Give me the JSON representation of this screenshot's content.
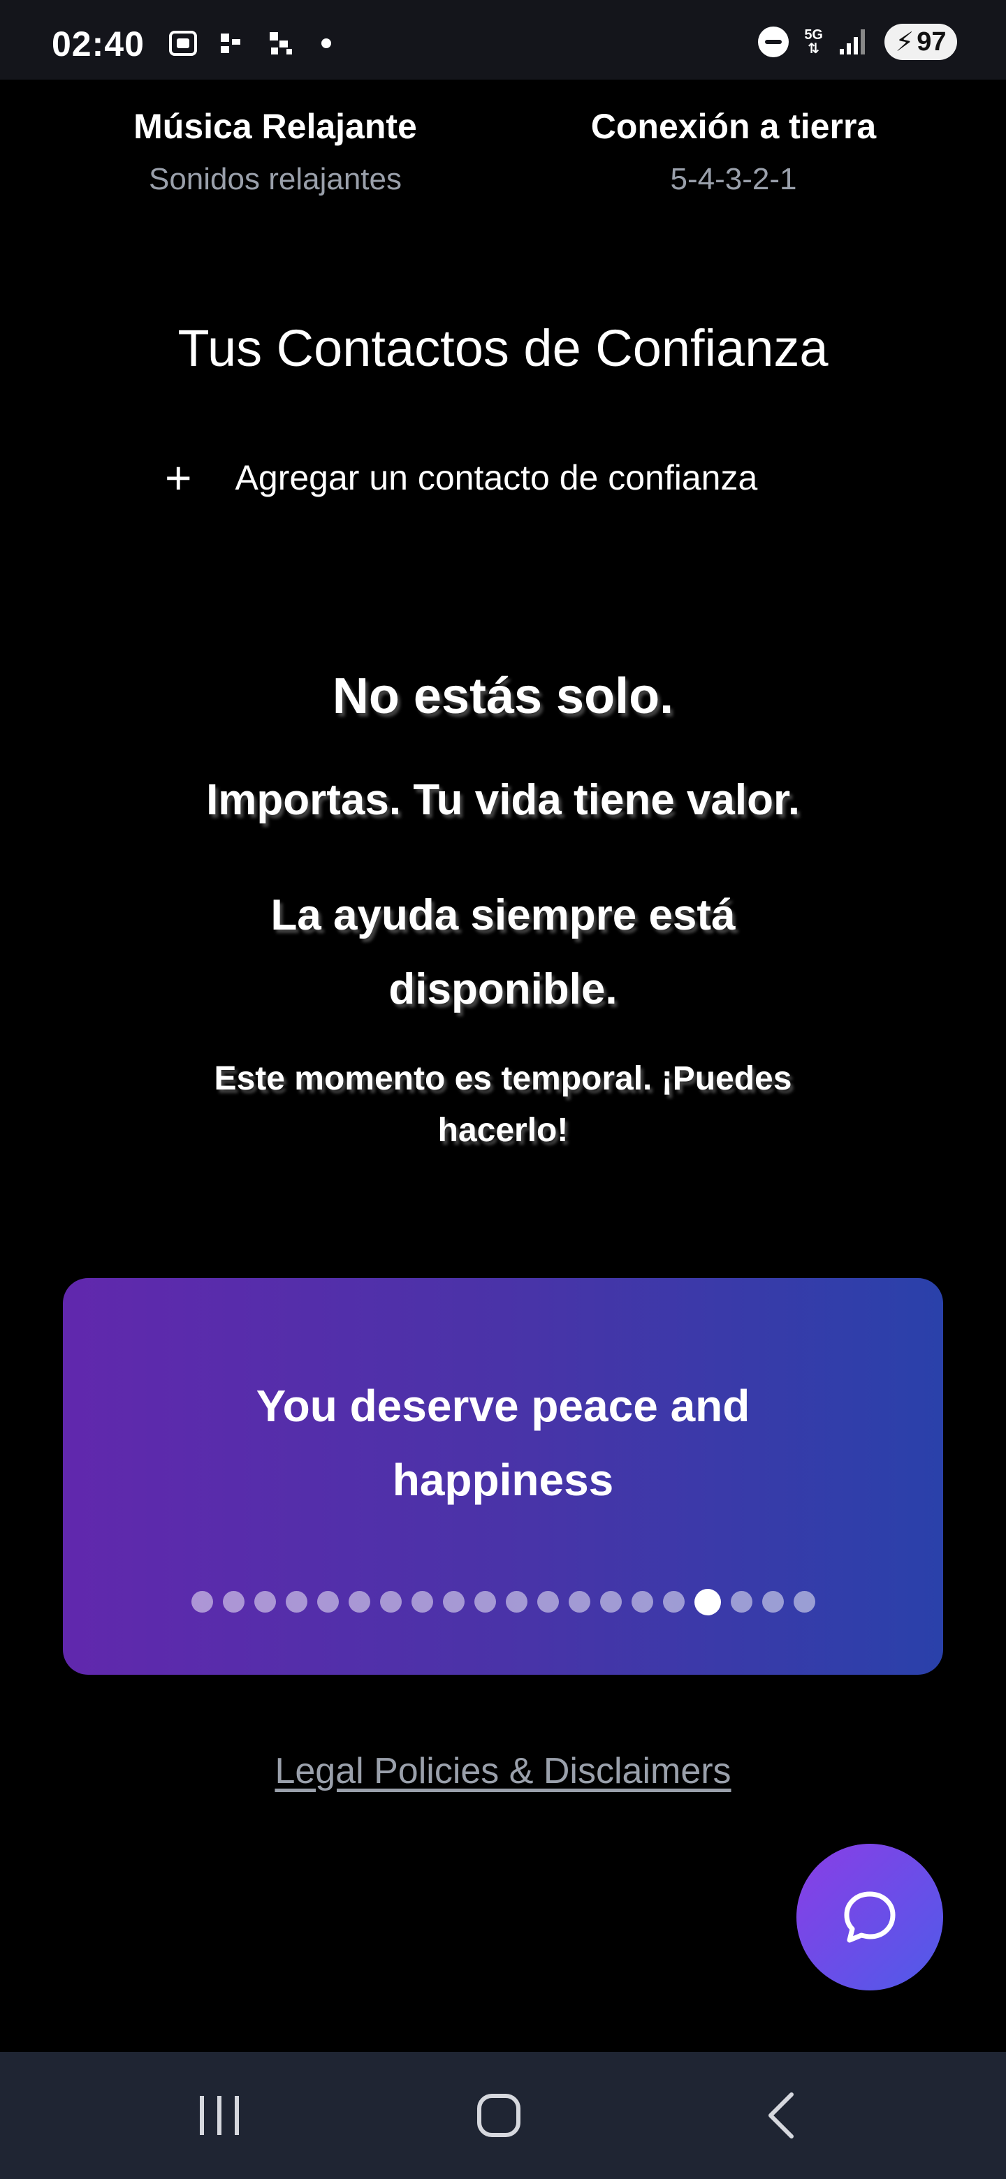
{
  "status_bar": {
    "time": "02:40",
    "network": "5G",
    "battery": "97"
  },
  "features": [
    {
      "title": "Música Relajante",
      "subtitle": "Sonidos relajantes"
    },
    {
      "title": "Conexión a tierra",
      "subtitle": "5-4-3-2-1"
    }
  ],
  "contacts": {
    "title": "Tus Contactos de Confianza",
    "add_label": "Agregar un contacto de confianza",
    "add_icon": "+"
  },
  "messages": {
    "line1": "No estás solo.",
    "line2": "Importas. Tu vida tiene valor.",
    "line3": "La ayuda siempre está disponible.",
    "line4": "Este momento es temporal. ¡Puedes hacerlo!"
  },
  "affirmation_card": {
    "text": "You deserve peace and happiness",
    "total_slides": 20,
    "active_slide": 17
  },
  "legal_link": "Legal Policies & Disclaimers",
  "colors": {
    "card_gradient_start": "#6128ad",
    "card_gradient_end": "#2a41aa",
    "fab_gradient_start": "#8a3ee6",
    "fab_gradient_end": "#4f5be9",
    "muted_text": "#9aa0ab"
  },
  "icons": {
    "chat_button": "chat-bubble-icon",
    "nav_recent": "recent-apps-icon",
    "nav_home": "home-icon",
    "nav_back": "back-icon"
  }
}
